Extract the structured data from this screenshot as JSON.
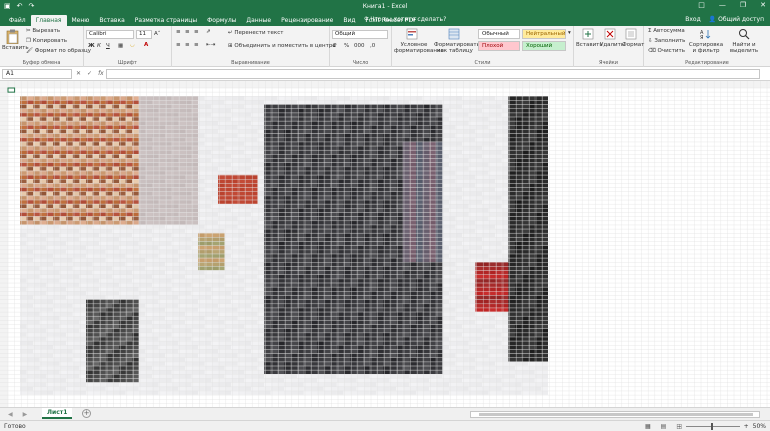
{
  "titlebar": {
    "title": "Книга1 - Excel",
    "quick_access": [
      "save-icon",
      "undo-icon",
      "redo-icon"
    ],
    "window_controls": [
      "ribbon-display-icon",
      "minimize-icon",
      "restore-icon",
      "close-icon"
    ]
  },
  "tabs": [
    "Файл",
    "Главная",
    "Меню",
    "Вставка",
    "Разметка страницы",
    "Формулы",
    "Данные",
    "Рецензирование",
    "Вид",
    "Foxit Reader PDF"
  ],
  "active_tab": "Главная",
  "tell_me": "Что вы хотите сделать?",
  "user": {
    "login": "Вход",
    "share": "Общий доступ"
  },
  "ribbon": {
    "clipboard": {
      "paste": "Вставить",
      "cut": "Вырезать",
      "copy": "Копировать",
      "format_painter": "Формат по образцу",
      "label": "Буфер обмена"
    },
    "font": {
      "name": "Calibri",
      "size": "11",
      "label": "Шрифт"
    },
    "alignment": {
      "wrap": "Перенести текст",
      "merge": "Объединить и поместить в центре",
      "label": "Выравнивание"
    },
    "number": {
      "format": "Общий",
      "label": "Число"
    },
    "styles": {
      "conditional": "Условное форматирование",
      "as_table": "Форматировать как таблицу",
      "normal": "Обычный",
      "neutral": "Нейтральный",
      "bad": "Плохой",
      "good": "Хороший",
      "label": "Стили"
    },
    "cells": {
      "insert": "Вставить",
      "delete": "Удалить",
      "format": "Формат",
      "label": "Ячейки"
    },
    "editing": {
      "autosum": "Автосумма",
      "fill": "Заполнить",
      "clear": "Очистить",
      "sort": "Сортировка и фильтр",
      "find": "Найти и выделить",
      "label": "Редактирование"
    }
  },
  "formula_bar": {
    "name_box": "A1",
    "fx": "fx",
    "value": ""
  },
  "sheet": {
    "tab": "Лист1",
    "status": "Готово",
    "zoom": "50%"
  },
  "colors": {
    "accent": "#217346",
    "ribbon_bg": "#f3f3f3"
  }
}
